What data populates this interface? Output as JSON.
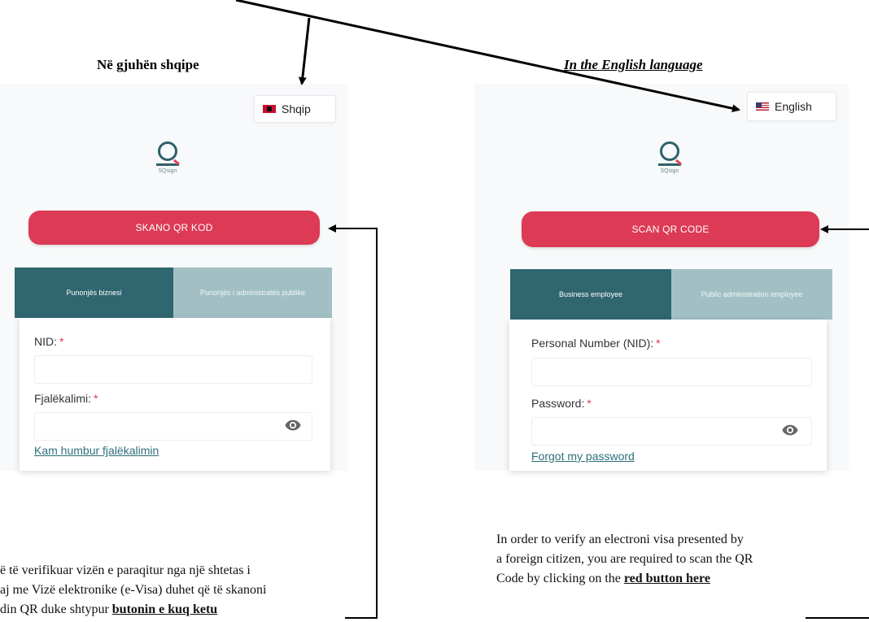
{
  "headings": {
    "albanian": "Në gjuhën shqipe",
    "english": "In the English language"
  },
  "albanian_panel": {
    "language_button": "Shqip",
    "logo_text": "SQsign",
    "scan_button": "SKANO QR KOD",
    "tabs": [
      "Punonjës biznesi",
      "Punonjës i administratës publike"
    ],
    "field1_label": "NID:",
    "field2_label": "Fjalëkalimi:",
    "required_mark": "*",
    "forgot_link": "Kam humbur fjalëkalimin"
  },
  "english_panel": {
    "language_button": "English",
    "logo_text": "SQsign",
    "scan_button": "SCAN QR CODE",
    "tabs": [
      "Business employee",
      "Public administration employee"
    ],
    "field1_label": "Personal Number (NID):",
    "field2_label": "Password:",
    "required_mark": "*",
    "forgot_link": "Forgot my password"
  },
  "albanian_description": {
    "line1": "ë të verifikuar vizën e paraqitur nga një shtetas i",
    "line2": "aj me Vizë elektronike (e-Visa) duhet që të skanoni",
    "line3_prefix": "din QR duke shtypur ",
    "line3_bold": "butonin e kuq  ketu"
  },
  "english_description": {
    "line1": "In order to verify an electroni visa presented by",
    "line2": "a foreign citizen, you are required to scan the QR",
    "line3_prefix": "Code by clicking on the ",
    "line3_bold": "red  button here"
  },
  "colors": {
    "accent_red": "#dc3a55",
    "tab_active": "#2f6670",
    "tab_inactive": "#a2c0c4",
    "link": "#2d6f79"
  }
}
